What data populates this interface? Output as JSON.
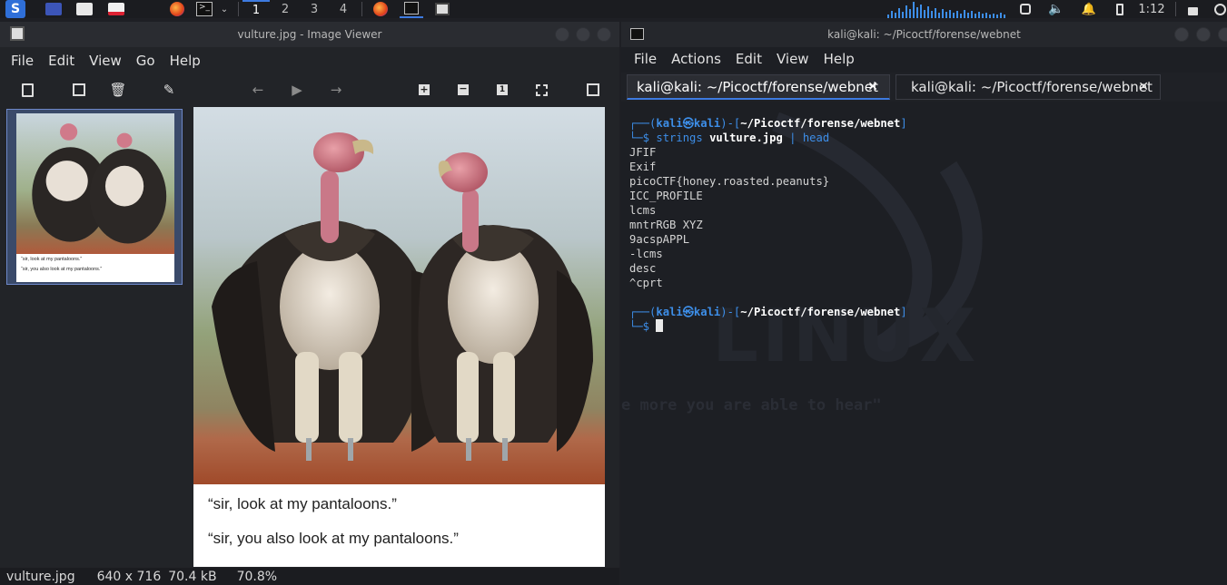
{
  "taskbar": {
    "workspaces": [
      "1",
      "2",
      "3",
      "4"
    ],
    "clock": "1:12"
  },
  "viewer": {
    "title": "vulture.jpg - Image Viewer",
    "menu": [
      "File",
      "Edit",
      "View",
      "Go",
      "Help"
    ],
    "caption1": "“sir, look at my pantaloons.”",
    "caption2": "“sir, you also look at my pantaloons.”",
    "status": {
      "filename": "vulture.jpg",
      "dimensions": "640 x 716",
      "size": "70.4 kB",
      "zoom": "70.8%"
    }
  },
  "terminal": {
    "title": "kali@kali: ~/Picoctf/forense/webnet",
    "menu": [
      "File",
      "Actions",
      "Edit",
      "View",
      "Help"
    ],
    "tabs": [
      "kali@kali: ~/Picoctf/forense/webnet",
      "kali@kali: ~/Picoctf/forense/webnet"
    ],
    "prompt_user": "kali㉿kali",
    "prompt_dir": "~/Picoctf/forense/webnet",
    "command_name": "strings",
    "command_arg": "vulture.jpg",
    "command_pipe": "| head",
    "output": [
      "JFIF",
      "Exif",
      "picoCTF{honey.roasted.peanuts}",
      "ICC_PROFILE",
      "lcms",
      "mntrRGB XYZ",
      "9acspAPPL",
      "-lcms",
      "desc",
      "^cprt"
    ],
    "bg_text": "e more you are able to hear\"",
    "bg_logo": "LINUX"
  },
  "colors": {
    "accent": "#3d7ae0",
    "prompt": "#3d8ee8",
    "terminal_bg": "#1d1f24"
  }
}
